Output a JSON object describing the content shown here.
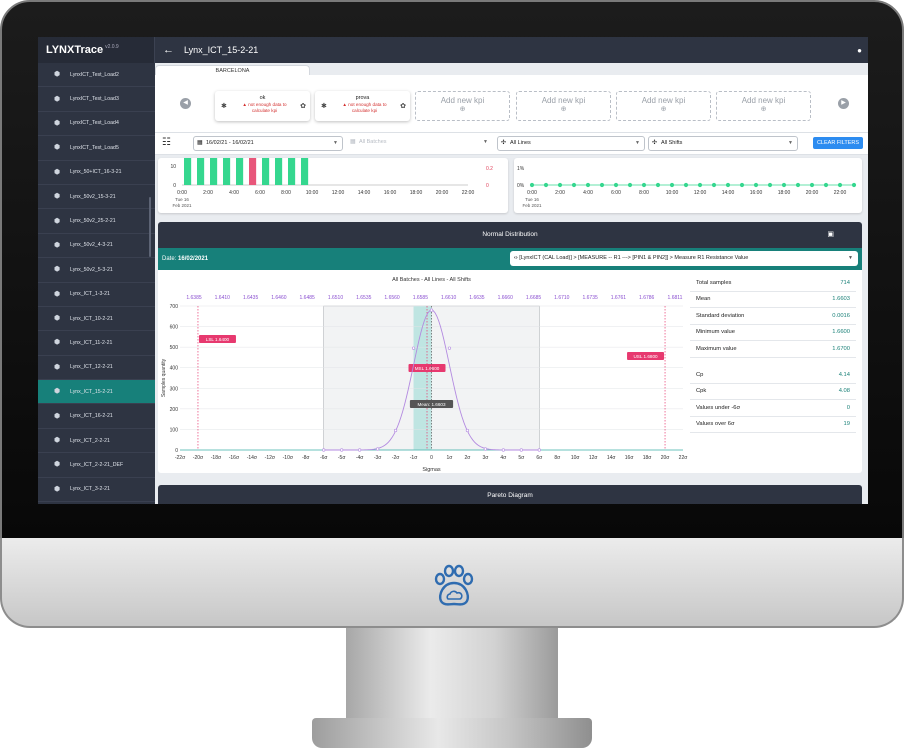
{
  "app": {
    "name": "LYNXTrace",
    "version": "v2.0.9",
    "page_title": "Lynx_ICT_15-2-21"
  },
  "sidebar": {
    "items": [
      {
        "label": "LynxICT_Test_Load2"
      },
      {
        "label": "LynxICT_Test_Load3"
      },
      {
        "label": "LynxICT_Test_Load4"
      },
      {
        "label": "LynxICT_Test_Load5"
      },
      {
        "label": "Lynx_50+ICT_16-3-21"
      },
      {
        "label": "Lynx_50v2_15-3-21"
      },
      {
        "label": "Lynx_50v2_25-2-21"
      },
      {
        "label": "Lynx_50v2_4-3-21"
      },
      {
        "label": "Lynx_50v2_5-3-21"
      },
      {
        "label": "Lynx_ICT_1-3-21"
      },
      {
        "label": "Lynx_ICT_10-2-21"
      },
      {
        "label": "Lynx_ICT_11-2-21"
      },
      {
        "label": "Lynx_ICT_12-2-21"
      },
      {
        "label": "Lynx_ICT_15-2-21",
        "active": true
      },
      {
        "label": "Lynx_ICT_16-2-21"
      },
      {
        "label": "Lynx_ICT_2-2-21"
      },
      {
        "label": "Lynx_ICT_2-2-21_DEF"
      },
      {
        "label": "Lynx_ICT_3-2-21"
      }
    ]
  },
  "tab": {
    "label": "BARCELONA"
  },
  "kpis": [
    {
      "name": "ok",
      "message": "not enough data to calculate kpi",
      "empty": false
    },
    {
      "name": "prova",
      "message": "not enough data to calculate kpi",
      "empty": false
    },
    {
      "label": "Add new kpi",
      "empty": true
    },
    {
      "label": "Add new kpi",
      "empty": true
    },
    {
      "label": "Add new kpi",
      "empty": true
    },
    {
      "label": "Add new kpi",
      "empty": true
    }
  ],
  "filters": {
    "date_range": "16/02/21 - 16/02/21",
    "batches": "All Batches",
    "lines": "All Lines",
    "shifts": "All Shifts",
    "clear_label": "CLEAR FILTERS"
  },
  "top_charts": {
    "left": {
      "y_ticks": [
        "10",
        "0"
      ],
      "right_ticks": [
        "0.2",
        "0"
      ],
      "x_ticks": [
        "0:00",
        "2:00",
        "4:00",
        "6:00",
        "8:00",
        "10:00",
        "12:00",
        "14:00",
        "16:00",
        "18:00",
        "20:00",
        "22:00"
      ],
      "date_label_1": "Tue 16",
      "date_label_2": "Feb 2021",
      "bar_hours": [
        0,
        1,
        2,
        3,
        4,
        5,
        6,
        7,
        8,
        9
      ],
      "highlight_hours": [
        5
      ]
    },
    "right": {
      "y_ticks": [
        "1%",
        "0%"
      ],
      "x_ticks": [
        "0:00",
        "2:00",
        "4:00",
        "6:00",
        "8:00",
        "10:00",
        "12:00",
        "14:00",
        "16:00",
        "18:00",
        "20:00",
        "22:00"
      ],
      "date_label_1": "Tue 16",
      "date_label_2": "Feb 2021"
    }
  },
  "normal_distribution": {
    "header": "Normal Distribution",
    "date_label": "Date:",
    "date_value": "16/02/2021",
    "measure": "[LynxICT (CAL Load)] > [MEASURE -- R1 ---> [PIN1 & PIN2]] > Measure R1 Resistance Value",
    "chart_title": "All Batches - All Lines - All Shifts",
    "stats": [
      {
        "label": "Total samples",
        "value": "714"
      },
      {
        "label": "Mean",
        "value": "1.6603"
      },
      {
        "label": "Standard deviation",
        "value": "0.0016"
      },
      {
        "label": "Minimum value",
        "value": "1.6600"
      },
      {
        "label": "Maximum value",
        "value": "1.6700"
      }
    ],
    "stats2": [
      {
        "label": "Cp",
        "value": "4.14"
      },
      {
        "label": "Cpk",
        "value": "4.08"
      },
      {
        "label": "Values under -6σ",
        "value": "0"
      },
      {
        "label": "Values over 6σ",
        "value": "19"
      }
    ]
  },
  "chart_data": {
    "type": "line",
    "title": "All Batches - All Lines - All Shifts",
    "xlabel": "Sigmas",
    "ylabel": "Samples quantity",
    "ylim": [
      0,
      700
    ],
    "y_ticks": [
      0,
      100,
      200,
      300,
      400,
      500,
      600,
      700
    ],
    "x_ticks": [
      "-22σ",
      "-20σ",
      "-18σ",
      "-16σ",
      "-14σ",
      "-12σ",
      "-10σ",
      "-8σ",
      "-6σ",
      "-5σ",
      "-4σ",
      "-3σ",
      "-2σ",
      "-1σ",
      "0",
      "1σ",
      "2σ",
      "3σ",
      "4σ",
      "5σ",
      "6σ",
      "8σ",
      "10σ",
      "12σ",
      "14σ",
      "16σ",
      "18σ",
      "20σ",
      "22σ"
    ],
    "top_ticks": [
      "1.6385",
      "1.6410",
      "1.6435",
      "1.6460",
      "1.6485",
      "1.6510",
      "1.6535",
      "1.6560",
      "1.6585",
      "1.6610",
      "1.6635",
      "1.6660",
      "1.6685",
      "1.6710",
      "1.6735",
      "1.6761",
      "1.6786",
      "1.6811"
    ],
    "series": [
      {
        "x": [
          -6,
          -5,
          -4,
          -3,
          -2,
          -1,
          0,
          1,
          2,
          3,
          4,
          5,
          6
        ],
        "values": [
          0,
          0,
          0,
          5,
          95,
          495,
          680,
          495,
          95,
          5,
          0,
          0,
          0
        ]
      }
    ],
    "markers": [
      {
        "label": "LSL 1.6400",
        "sigma": -20,
        "color": "#e7396f"
      },
      {
        "label": "USL 1.6800",
        "sigma": 20,
        "color": "#e7396f"
      },
      {
        "label": "MSL 1.6600",
        "sigma": -0.25,
        "color": "#e7396f"
      },
      {
        "label": "Mean: 1.6603",
        "sigma": 0,
        "color": "#555555"
      }
    ]
  },
  "pareto": {
    "header": "Pareto Diagram"
  }
}
